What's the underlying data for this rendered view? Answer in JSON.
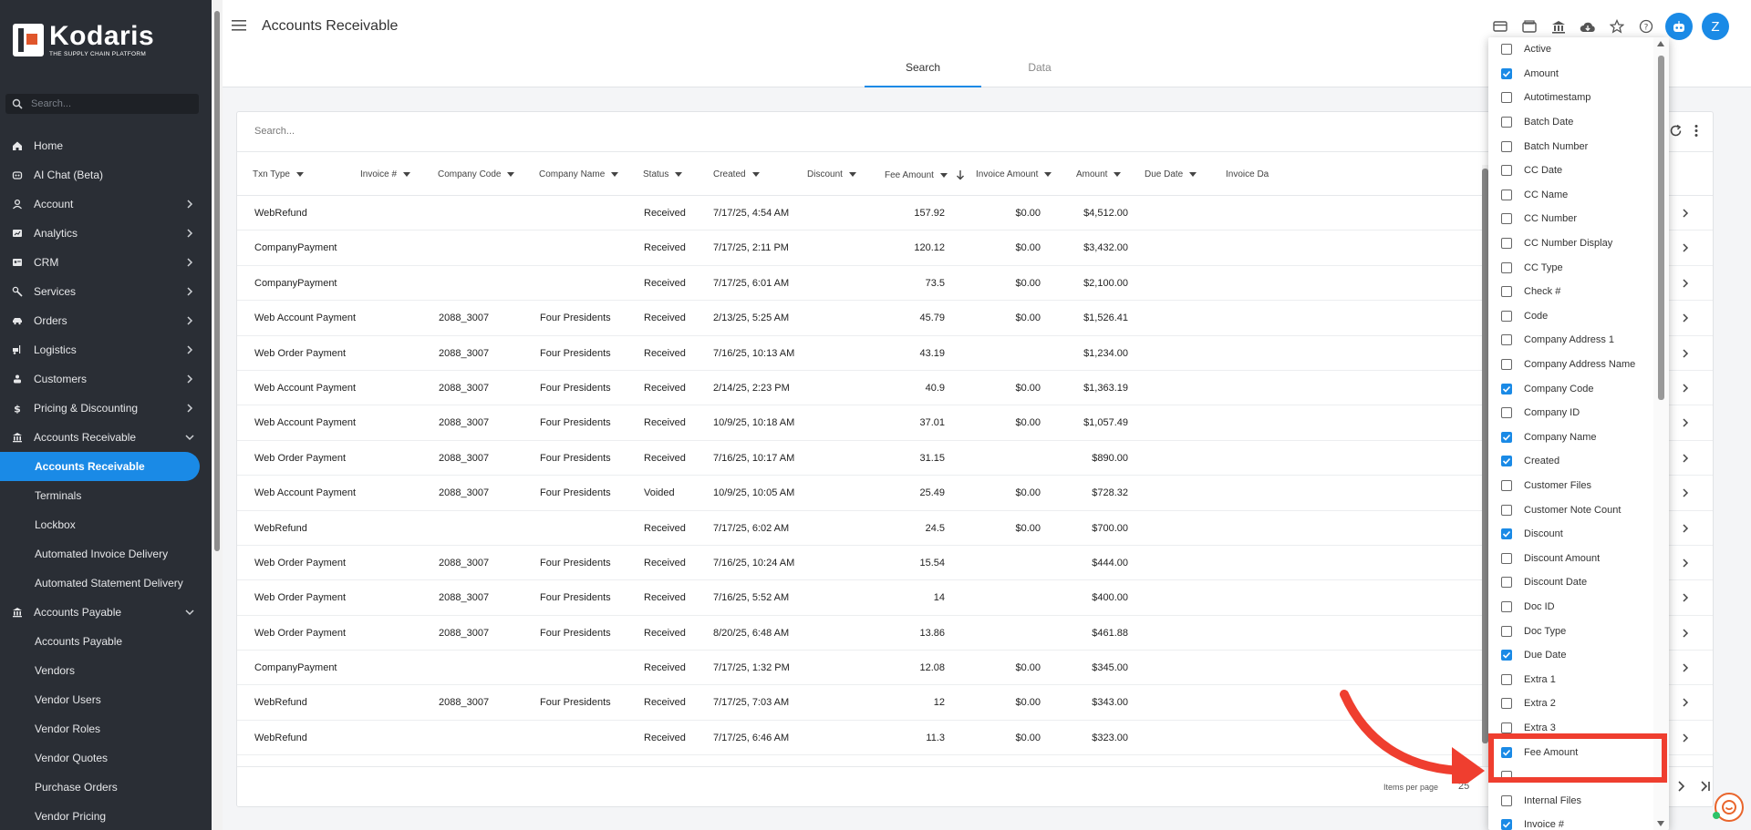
{
  "brand": {
    "name": "Kodaris",
    "tagline": "THE SUPPLY CHAIN PLATFORM"
  },
  "sidebar": {
    "search_placeholder": "Search...",
    "items": [
      {
        "label": "Home",
        "icon": "home-icon",
        "chevron": false,
        "sub": false
      },
      {
        "label": "AI Chat (Beta)",
        "icon": "robot-icon",
        "chevron": false,
        "sub": false
      },
      {
        "label": "Account",
        "icon": "person-icon",
        "chevron": true,
        "sub": false
      },
      {
        "label": "Analytics",
        "icon": "analytics-icon",
        "chevron": true,
        "sub": false
      },
      {
        "label": "CRM",
        "icon": "contact-card-icon",
        "chevron": true,
        "sub": false
      },
      {
        "label": "Services",
        "icon": "services-icon",
        "chevron": true,
        "sub": false
      },
      {
        "label": "Orders",
        "icon": "car-icon",
        "chevron": true,
        "sub": false
      },
      {
        "label": "Logistics",
        "icon": "forklift-icon",
        "chevron": true,
        "sub": false
      },
      {
        "label": "Customers",
        "icon": "customer-icon",
        "chevron": true,
        "sub": false
      },
      {
        "label": "Pricing & Discounting",
        "icon": "dollar-icon",
        "chevron": true,
        "sub": false
      },
      {
        "label": "Accounts Receivable",
        "icon": "bank-icon",
        "chevron": true,
        "expanded": true,
        "sub": false
      },
      {
        "label": "Accounts Receivable",
        "sub": true,
        "active": true
      },
      {
        "label": "Terminals",
        "sub": true
      },
      {
        "label": "Lockbox",
        "sub": true
      },
      {
        "label": "Automated Invoice Delivery",
        "sub": true
      },
      {
        "label": "Automated Statement Delivery",
        "sub": true
      },
      {
        "label": "Accounts Payable",
        "icon": "bank-icon",
        "chevron": true,
        "expanded": true,
        "sub": false
      },
      {
        "label": "Accounts Payable",
        "sub": true
      },
      {
        "label": "Vendors",
        "sub": true
      },
      {
        "label": "Vendor Users",
        "sub": true
      },
      {
        "label": "Vendor Roles",
        "sub": true
      },
      {
        "label": "Vendor Quotes",
        "sub": true
      },
      {
        "label": "Purchase Orders",
        "sub": true
      },
      {
        "label": "Vendor Pricing",
        "sub": true
      }
    ]
  },
  "header": {
    "title": "Accounts Receivable",
    "avatar_initial": "Z"
  },
  "tabs": [
    "Search",
    "Data"
  ],
  "grid": {
    "search_placeholder": "Search...",
    "columns": [
      "Txn Type",
      "Invoice #",
      "Company Code",
      "Company Name",
      "Status",
      "Created",
      "Discount",
      "Fee Amount",
      "Invoice Amount",
      "Amount",
      "Due Date",
      "Invoice Da"
    ],
    "rows": [
      [
        "WebRefund",
        "",
        "",
        "",
        "Received",
        "7/17/25, 4:54 AM",
        "",
        "157.92",
        "$0.00",
        "$4,512.00"
      ],
      [
        "CompanyPayment",
        "",
        "",
        "",
        "Received",
        "7/17/25, 2:11 PM",
        "",
        "120.12",
        "$0.00",
        "$3,432.00"
      ],
      [
        "CompanyPayment",
        "",
        "",
        "",
        "Received",
        "7/17/25, 6:01 AM",
        "",
        "73.5",
        "$0.00",
        "$2,100.00"
      ],
      [
        "Web Account Payment",
        "",
        "2088_3007",
        "Four Presidents",
        "Received",
        "2/13/25, 5:25 AM",
        "",
        "45.79",
        "$0.00",
        "$1,526.41"
      ],
      [
        "Web Order Payment",
        "",
        "2088_3007",
        "Four Presidents",
        "Received",
        "7/16/25, 10:13 AM",
        "",
        "43.19",
        "",
        "$1,234.00"
      ],
      [
        "Web Account Payment",
        "",
        "2088_3007",
        "Four Presidents",
        "Received",
        "2/14/25, 2:23 PM",
        "",
        "40.9",
        "$0.00",
        "$1,363.19"
      ],
      [
        "Web Account Payment",
        "",
        "2088_3007",
        "Four Presidents",
        "Received",
        "10/9/25, 10:18 AM",
        "",
        "37.01",
        "$0.00",
        "$1,057.49"
      ],
      [
        "Web Order Payment",
        "",
        "2088_3007",
        "Four Presidents",
        "Received",
        "7/16/25, 10:17 AM",
        "",
        "31.15",
        "",
        "$890.00"
      ],
      [
        "Web Account Payment",
        "",
        "2088_3007",
        "Four Presidents",
        "Voided",
        "10/9/25, 10:05 AM",
        "",
        "25.49",
        "$0.00",
        "$728.32"
      ],
      [
        "WebRefund",
        "",
        "",
        "",
        "Received",
        "7/17/25, 6:02 AM",
        "",
        "24.5",
        "$0.00",
        "$700.00"
      ],
      [
        "Web Order Payment",
        "",
        "2088_3007",
        "Four Presidents",
        "Received",
        "7/16/25, 10:24 AM",
        "",
        "15.54",
        "",
        "$444.00"
      ],
      [
        "Web Order Payment",
        "",
        "2088_3007",
        "Four Presidents",
        "Received",
        "7/16/25, 5:52 AM",
        "",
        "14",
        "",
        "$400.00"
      ],
      [
        "Web Order Payment",
        "",
        "2088_3007",
        "Four Presidents",
        "Received",
        "8/20/25, 6:48 AM",
        "",
        "13.86",
        "",
        "$461.88"
      ],
      [
        "CompanyPayment",
        "",
        "",
        "",
        "Received",
        "7/17/25, 1:32 PM",
        "",
        "12.08",
        "$0.00",
        "$345.00"
      ],
      [
        "WebRefund",
        "",
        "2088_3007",
        "Four Presidents",
        "Received",
        "7/17/25, 7:03 AM",
        "",
        "12",
        "$0.00",
        "$343.00"
      ],
      [
        "WebRefund",
        "",
        "",
        "",
        "Received",
        "7/17/25, 6:46 AM",
        "",
        "11.3",
        "$0.00",
        "$323.00"
      ]
    ],
    "pager": {
      "items_per_page_label": "Items per page",
      "items_per_page_value": "25"
    }
  },
  "column_chooser": {
    "options": [
      {
        "label": "Active",
        "checked": false
      },
      {
        "label": "Amount",
        "checked": true
      },
      {
        "label": "Autotimestamp",
        "checked": false
      },
      {
        "label": "Batch Date",
        "checked": false
      },
      {
        "label": "Batch Number",
        "checked": false
      },
      {
        "label": "CC Date",
        "checked": false
      },
      {
        "label": "CC Name",
        "checked": false
      },
      {
        "label": "CC Number",
        "checked": false
      },
      {
        "label": "CC Number Display",
        "checked": false
      },
      {
        "label": "CC Type",
        "checked": false
      },
      {
        "label": "Check #",
        "checked": false
      },
      {
        "label": "Code",
        "checked": false
      },
      {
        "label": "Company Address 1",
        "checked": false
      },
      {
        "label": "Company Address Name",
        "checked": false
      },
      {
        "label": "Company Code",
        "checked": true
      },
      {
        "label": "Company ID",
        "checked": false
      },
      {
        "label": "Company Name",
        "checked": true
      },
      {
        "label": "Created",
        "checked": true
      },
      {
        "label": "Customer Files",
        "checked": false
      },
      {
        "label": "Customer Note Count",
        "checked": false
      },
      {
        "label": "Discount",
        "checked": true
      },
      {
        "label": "Discount Amount",
        "checked": false
      },
      {
        "label": "Discount Date",
        "checked": false
      },
      {
        "label": "Doc ID",
        "checked": false
      },
      {
        "label": "Doc Type",
        "checked": false
      },
      {
        "label": "Due Date",
        "checked": true
      },
      {
        "label": "Extra 1",
        "checked": false
      },
      {
        "label": "Extra 2",
        "checked": false
      },
      {
        "label": "Extra 3",
        "checked": false
      },
      {
        "label": "Fee Amount",
        "checked": true
      },
      {
        "label": "",
        "checked": false
      },
      {
        "label": "Internal Files",
        "checked": false
      },
      {
        "label": "Invoice #",
        "checked": true
      }
    ]
  },
  "colors": {
    "accent": "#1a8ae6",
    "sidebar_bg": "#2a2e35",
    "annotation": "#ef3e2f",
    "brand_orange": "#e0562b"
  }
}
